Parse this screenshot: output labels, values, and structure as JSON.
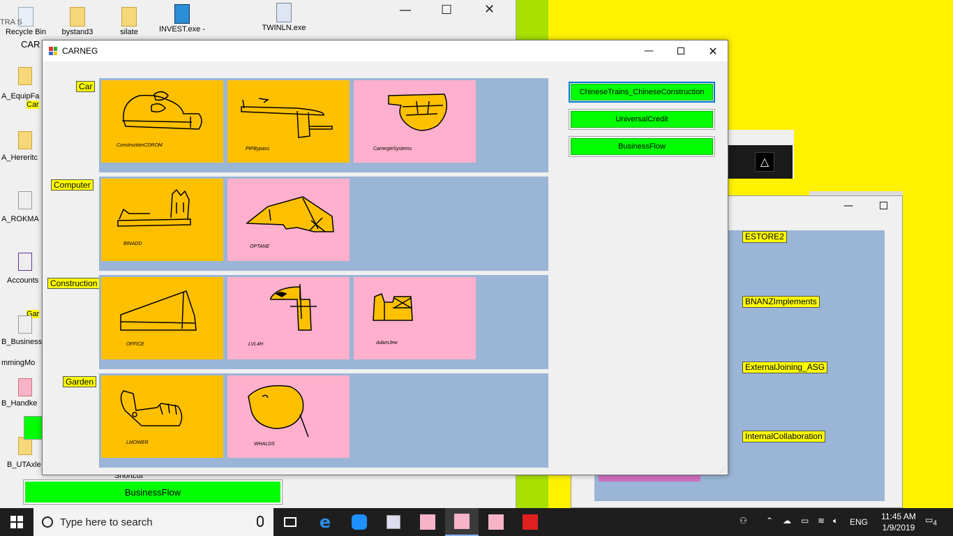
{
  "desktop": {
    "icons": [
      {
        "label": "Recycle Bin"
      },
      {
        "label": "bystand3"
      },
      {
        "label": "silate"
      },
      {
        "label": "INVEST.exe -"
      },
      {
        "label": "TWINLN.exe"
      }
    ],
    "left_labels": [
      "A_EquipFa",
      "A_Hereritc",
      "A_ROKMA",
      "Accounts",
      "B_Business",
      "mmingMo",
      "B_Handke",
      "B_UTAxle",
      "Shortcut"
    ],
    "partial_texts": [
      "TRA S",
      "CAR",
      "Car",
      "Gar"
    ]
  },
  "background_window": {
    "bottom_button": "BusinessFlow"
  },
  "right_window": {
    "labels": [
      "ESTORE2",
      "BNANZImplements",
      "ExternalJoining_ASG",
      "InternalCollaboration"
    ]
  },
  "main_window": {
    "title": "CARNEG",
    "categories": [
      {
        "label": "Car",
        "tiles": [
          {
            "caption": "ConstructionCDROM",
            "color": "orange"
          },
          {
            "caption": "PIPBypass",
            "color": "orange"
          },
          {
            "caption": "CarnegieSystems",
            "color": "pink"
          }
        ]
      },
      {
        "label": "Computer",
        "tiles": [
          {
            "caption": "BINADD",
            "color": "orange"
          },
          {
            "caption": "OPTANE",
            "color": "pink"
          }
        ]
      },
      {
        "label": "Construction",
        "tiles": [
          {
            "caption": "OFFICE",
            "color": "orange"
          },
          {
            "caption": "LVL4H",
            "color": "pink"
          },
          {
            "caption": "AdamJew",
            "color": "pink"
          }
        ]
      },
      {
        "label": "Garden",
        "tiles": [
          {
            "caption": "LMOWER",
            "color": "orange"
          },
          {
            "caption": "WHALDS",
            "color": "pink"
          }
        ]
      }
    ],
    "buttons": [
      "ChineseTrains_ChineseConstruction",
      "UniversalCredit",
      "BusinessFlow"
    ]
  },
  "taskbar": {
    "search_placeholder": "Type here to search",
    "language": "ENG",
    "time": "11:45 AM",
    "date": "1/9/2019",
    "notification_count": "4"
  },
  "colors": {
    "accent_green": "#00ff00",
    "label_yellow": "#ffff00",
    "tile_orange": "#ffc000",
    "tile_pink": "#ffb0cc",
    "panel_blue": "#9ab5d6",
    "desktop_yellow": "#fff200"
  }
}
